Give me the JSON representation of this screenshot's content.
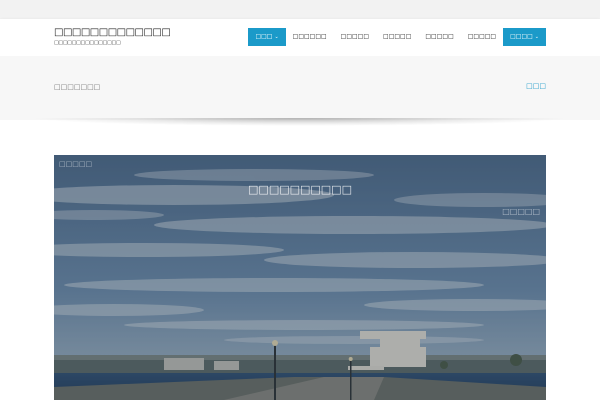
{
  "header": {
    "site_title": "□□□□□□□□□□□□□",
    "site_tagline": "□□□□□□□□□□□□□□□"
  },
  "nav": {
    "items": [
      {
        "label": "□□□",
        "active": true,
        "has_dropdown": true
      },
      {
        "label": "□□□□□□",
        "active": false,
        "has_dropdown": false
      },
      {
        "label": "□□□□□",
        "active": false,
        "has_dropdown": false
      },
      {
        "label": "□□□□□",
        "active": false,
        "has_dropdown": false
      },
      {
        "label": "□□□□□",
        "active": false,
        "has_dropdown": false
      },
      {
        "label": "□□□□□",
        "active": false,
        "has_dropdown": false
      },
      {
        "label": "□□□□",
        "active": true,
        "has_dropdown": true
      }
    ],
    "dropdown_icon": "chevron-down-icon",
    "dropdown_glyph": "⌄"
  },
  "titlebar": {
    "page_title": "□□□□□□□",
    "breadcrumb": "□□□"
  },
  "hero": {
    "label_top_left": "□□□□□",
    "title": "□□□□□□□□□□",
    "label_right": "□□□□□"
  },
  "colors": {
    "accent": "#1b9ac9",
    "topbar": "#f2f2f2",
    "titlebar": "#f7f7f7"
  }
}
